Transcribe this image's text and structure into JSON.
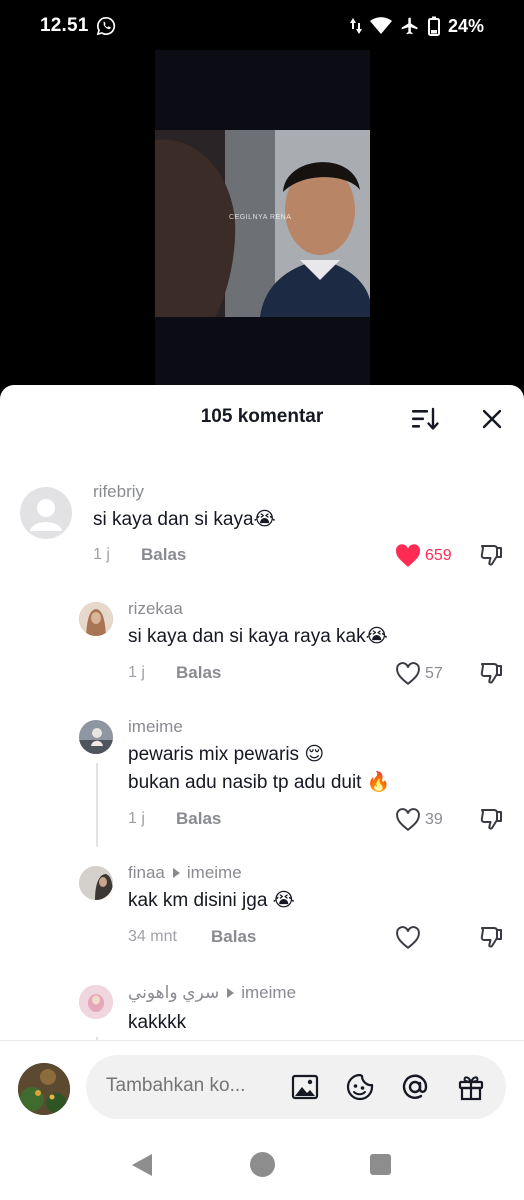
{
  "status_bar": {
    "time": "12.51",
    "battery": "24%",
    "icons": [
      "whatsapp-icon",
      "data-arrows-icon",
      "wifi-icon",
      "airplane-icon",
      "battery-icon"
    ]
  },
  "video": {
    "watermark": "CEGILNYA RENA"
  },
  "comments_panel": {
    "title": "105 komentar",
    "sort_icon": "sort-icon",
    "close_icon": "close-icon"
  },
  "comments": [
    {
      "user": "rifebriy",
      "reply_to": "",
      "text": "si kaya dan si kaya😭",
      "time": "1 j",
      "reply_label": "Balas",
      "likes": "659",
      "liked": true,
      "level": 0
    },
    {
      "user": "rizekaa",
      "reply_to": "",
      "text": "si kaya dan si kaya raya kak😭",
      "time": "1 j",
      "reply_label": "Balas",
      "likes": "57",
      "liked": false,
      "level": 1
    },
    {
      "user": "imeime",
      "reply_to": "",
      "text": "pewaris mix pewaris 😌",
      "text2": "bukan adu nasib tp adu duit 🔥",
      "time": "1 j",
      "reply_label": "Balas",
      "likes": "39",
      "liked": false,
      "level": 1
    },
    {
      "user": "finaa",
      "reply_to": "imeime",
      "text": "kak km disini jga 😭",
      "time": "34 mnt",
      "reply_label": "Balas",
      "likes": "",
      "liked": false,
      "level": 1
    },
    {
      "user": "سري واهوني",
      "reply_to": "imeime",
      "text": "kakkkk",
      "level": 1
    }
  ],
  "input_bar": {
    "placeholder": "Tambahkan ko...",
    "icons": [
      "image-icon",
      "sticker-icon",
      "mention-icon",
      "gift-icon"
    ]
  },
  "colors": {
    "like_active": "#fe2c55",
    "text_primary": "#161823",
    "text_secondary": "#8a8b91"
  }
}
